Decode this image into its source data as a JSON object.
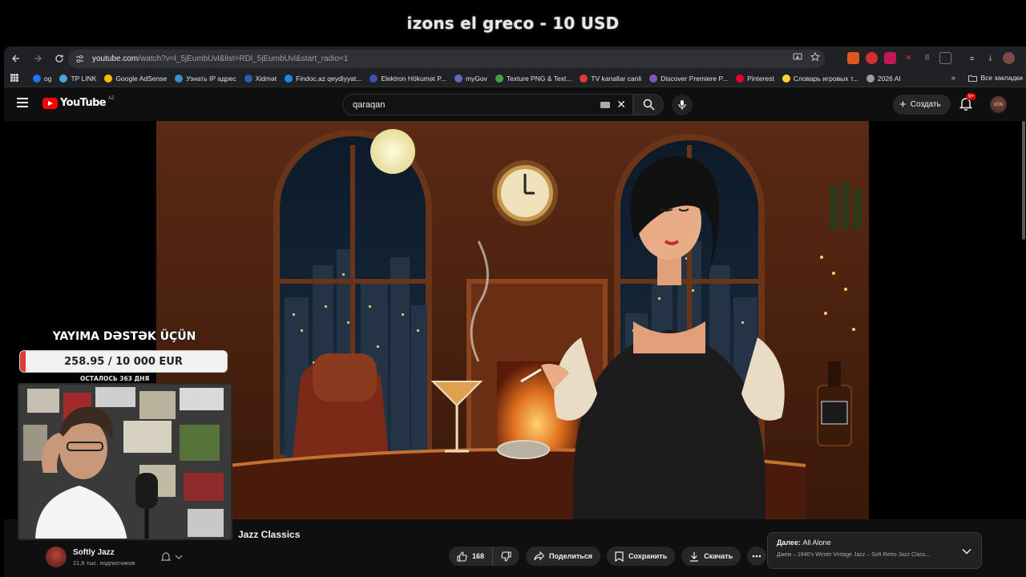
{
  "stream_banner": {
    "text": "izons el greco - 10 USD"
  },
  "browser": {
    "url_host": "youtube.com",
    "url_path": "/watch?v=l_5jEumbUvl&list=RDl_5jEumbUvl&start_radio=1",
    "bookmarks": [
      {
        "label": "og",
        "color": "#1877f2"
      },
      {
        "label": "TP LINK",
        "color": "#4aa8d8"
      },
      {
        "label": "Google AdSense",
        "color": "#fbbc04"
      },
      {
        "label": "Узнать IP адрес",
        "color": "#3b8fd0"
      },
      {
        "label": "Xidmət",
        "color": "#2a5db0"
      },
      {
        "label": "Findoc.az qeydiyyat...",
        "color": "#1e88e5"
      },
      {
        "label": "Elektron Hökumət P...",
        "color": "#3f51b5"
      },
      {
        "label": "myGov",
        "color": "#5c6bc0"
      },
      {
        "label": "Texture PNG & Text...",
        "color": "#43a047"
      },
      {
        "label": "TV kanallar canli",
        "color": "#e53935"
      },
      {
        "label": "Discover Premiere P...",
        "color": "#7e57c2"
      },
      {
        "label": "Pinterest",
        "color": "#e60023"
      },
      {
        "label": "Словарь игровых т...",
        "color": "#fdd835"
      },
      {
        "label": "2026 AI",
        "color": "#9e9e9e"
      }
    ],
    "bookmarks_all_label": "Все закладки"
  },
  "youtube": {
    "logo_text": "YouTube",
    "region": "AZ",
    "search_query": "qaraqan",
    "create_label": "Создать",
    "notifications_badge": "9+",
    "avatar_text": "IZON"
  },
  "video": {
    "title_visible": "Jazz Classics",
    "channel_name": "Softly Jazz",
    "channel_subs": "21,6 тыс. подписчиков",
    "likes": "168",
    "share_label": "Поделиться",
    "save_label": "Сохранить",
    "download_label": "Скачать",
    "up_next_prefix": "Далее:",
    "up_next_title": "All Alone",
    "up_next_sub": "Джем – 1940's Winter Vintage Jazz – Soft Retro Jazz Class..."
  },
  "stream_overlay": {
    "title": "YAYIMA DƏSTƏK ÜÇÜN",
    "goal_text": "258.95 / 10 000 EUR",
    "goal_progress": 0.026,
    "remaining": "ОСТАЛОСЬ 363 ДНЯ"
  },
  "colors": {
    "accent_red": "#ff0000",
    "goal_fill": "#e03a3a",
    "page_bg": "#0f0f0f"
  }
}
